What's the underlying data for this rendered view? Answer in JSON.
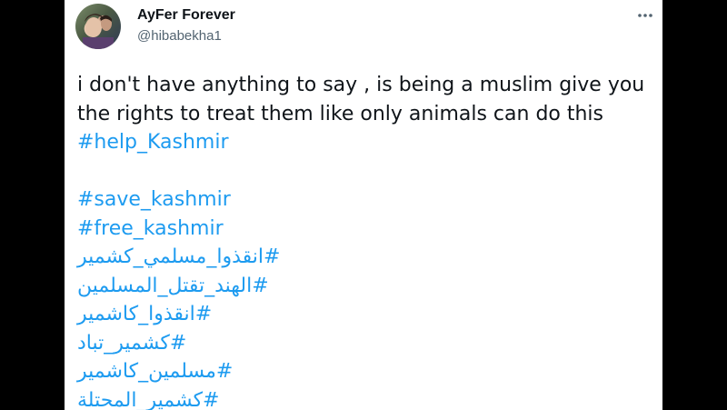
{
  "tweet_card": {
    "author": {
      "display_name": "AyFer Forever",
      "handle": "@hibabekha1"
    },
    "more_icon": "more-horizontal-icon",
    "body_lines": [
      "i don't have anything to say , is being a muslim give you",
      "the rights to treat them like  only animals can do this"
    ],
    "hashtags_first": "#help_Kashmir",
    "hashtags": [
      "#save_kashmir",
      "#free_kashmir",
      "#انقذوا_مسلمي_كشمير",
      "#الهند_تقتل_المسلمين",
      "#انقذوا_كاشمير",
      "#كشمير_تباد",
      "#مسلمين_كاشمير",
      "#كشمير_المحتلة"
    ],
    "colors": {
      "link": "#1d9bf0",
      "text": "#0f1419",
      "secondary": "#536471",
      "background": "#ffffff",
      "page_background": "#000000"
    }
  }
}
